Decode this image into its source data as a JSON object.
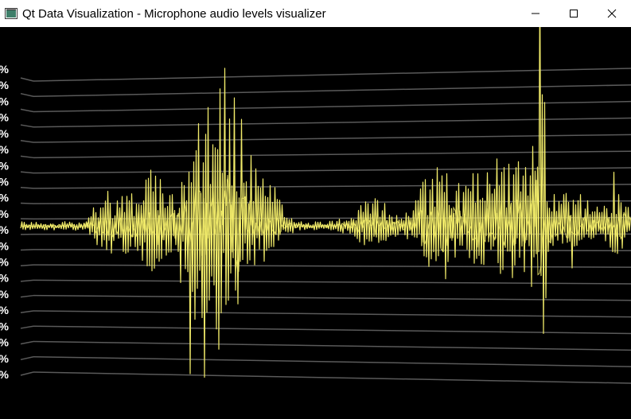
{
  "window": {
    "title": "Qt Data Visualization - Microphone audio levels visualizer",
    "icon": "qt-app-icon",
    "controls": [
      "minimize-icon",
      "maximize-icon",
      "close-icon"
    ]
  },
  "graph": {
    "type": "3d-surface-waveform",
    "axis_tick_suffix": "%",
    "grid_line_count": 20,
    "colors": {
      "background": "#000000",
      "grid": "#5a5a5a",
      "waveform": "#f2ec6a",
      "labels": "#ffffff"
    }
  }
}
